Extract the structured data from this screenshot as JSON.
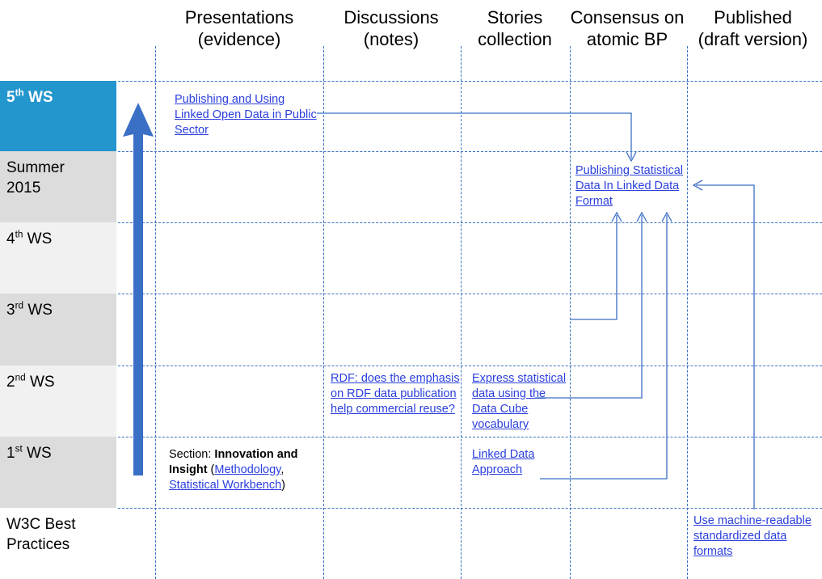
{
  "diagram": {
    "title": "W3C Best Practices workshop progression matrix",
    "accent_blue": "#2496ce",
    "link_blue": "#2b3fdd",
    "grid_blue": "#3b6fc4",
    "arrow_blue": "#3b6fc4",
    "timeline_arrow_color": "#3a6fc6",
    "row_shade_dark": "#dcdcdc",
    "row_shade_light": "#f1f1f1"
  },
  "columns": [
    {
      "id": "presentations",
      "line1": "Presentations",
      "line2": "(evidence)"
    },
    {
      "id": "discussions",
      "line1": "Discussions",
      "line2": "(notes)"
    },
    {
      "id": "stories",
      "line1": "Stories",
      "line2": "collection"
    },
    {
      "id": "consensus",
      "line1": "Consensus on",
      "line2": "atomic BP"
    },
    {
      "id": "published",
      "line1": "Published",
      "line2": "(draft version)"
    }
  ],
  "rows": [
    {
      "id": "ws5",
      "label_main": "5",
      "label_sup": "th",
      "label_rest": " WS",
      "style": "highlight"
    },
    {
      "id": "summer",
      "label_main": "Summer",
      "label_sup": "",
      "label_rest": "",
      "label_line2": "2015",
      "style": "shade-dark"
    },
    {
      "id": "ws4",
      "label_main": "4",
      "label_sup": "th",
      "label_rest": " WS",
      "style": "shade-light"
    },
    {
      "id": "ws3",
      "label_main": "3",
      "label_sup": "rd",
      "label_rest": " WS",
      "style": "shade-dark"
    },
    {
      "id": "ws2",
      "label_main": "2",
      "label_sup": "nd",
      "label_rest": " WS",
      "style": "shade-light"
    },
    {
      "id": "ws1",
      "label_main": "1",
      "label_sup": "st",
      "label_rest": " WS",
      "style": "shade-dark"
    },
    {
      "id": "w3cbp",
      "label_main": "W3C Best",
      "label_sup": "",
      "label_rest": "",
      "label_line2": "Practices",
      "style": "plain"
    }
  ],
  "cells": {
    "ws5_presentations": {
      "kind": "link",
      "text": "Publishing and Using Linked Open Data in Public Sector"
    },
    "summer_consensus": {
      "kind": "link",
      "text": "Publishing Statistical Data In Linked Data Format"
    },
    "ws2_discussions": {
      "kind": "link",
      "text": "RDF: does the emphasis on RDF data publication help commercial reuse?"
    },
    "ws2_stories": {
      "kind": "link",
      "text": "Express statistical data using the Data Cube vocabulary"
    },
    "ws1_presentations": {
      "kind": "rich",
      "prefix": "Section: ",
      "bold": "Innovation and Insight",
      "open_paren": " (",
      "link1": "Methodology",
      "sep": ", ",
      "link2": "Statistical Workbench",
      "close_paren": ")"
    },
    "ws1_stories": {
      "kind": "link",
      "text": "Linked Data Approach"
    },
    "w3cbp_published": {
      "kind": "link",
      "text": "Use machine-readable standardized data formats"
    }
  },
  "connectors": [
    {
      "id": "presentations-to-consensus",
      "from": "ws5_presentations",
      "to": "summer_consensus",
      "arrowhead": "down"
    },
    {
      "id": "ws3-stories-to-consensus",
      "from": "ws3_row",
      "to": "summer_consensus",
      "arrowhead": "up"
    },
    {
      "id": "ws2-stories-to-consensus",
      "from": "ws2_stories",
      "to": "summer_consensus",
      "arrowhead": "up"
    },
    {
      "id": "ws1-stories-to-consensus",
      "from": "ws1_stories",
      "to": "summer_consensus",
      "arrowhead": "up"
    },
    {
      "id": "published-to-consensus",
      "from": "w3cbp_published",
      "to": "summer_consensus",
      "arrowhead": "left"
    }
  ],
  "timeline_arrow": {
    "direction": "up",
    "label": ""
  }
}
